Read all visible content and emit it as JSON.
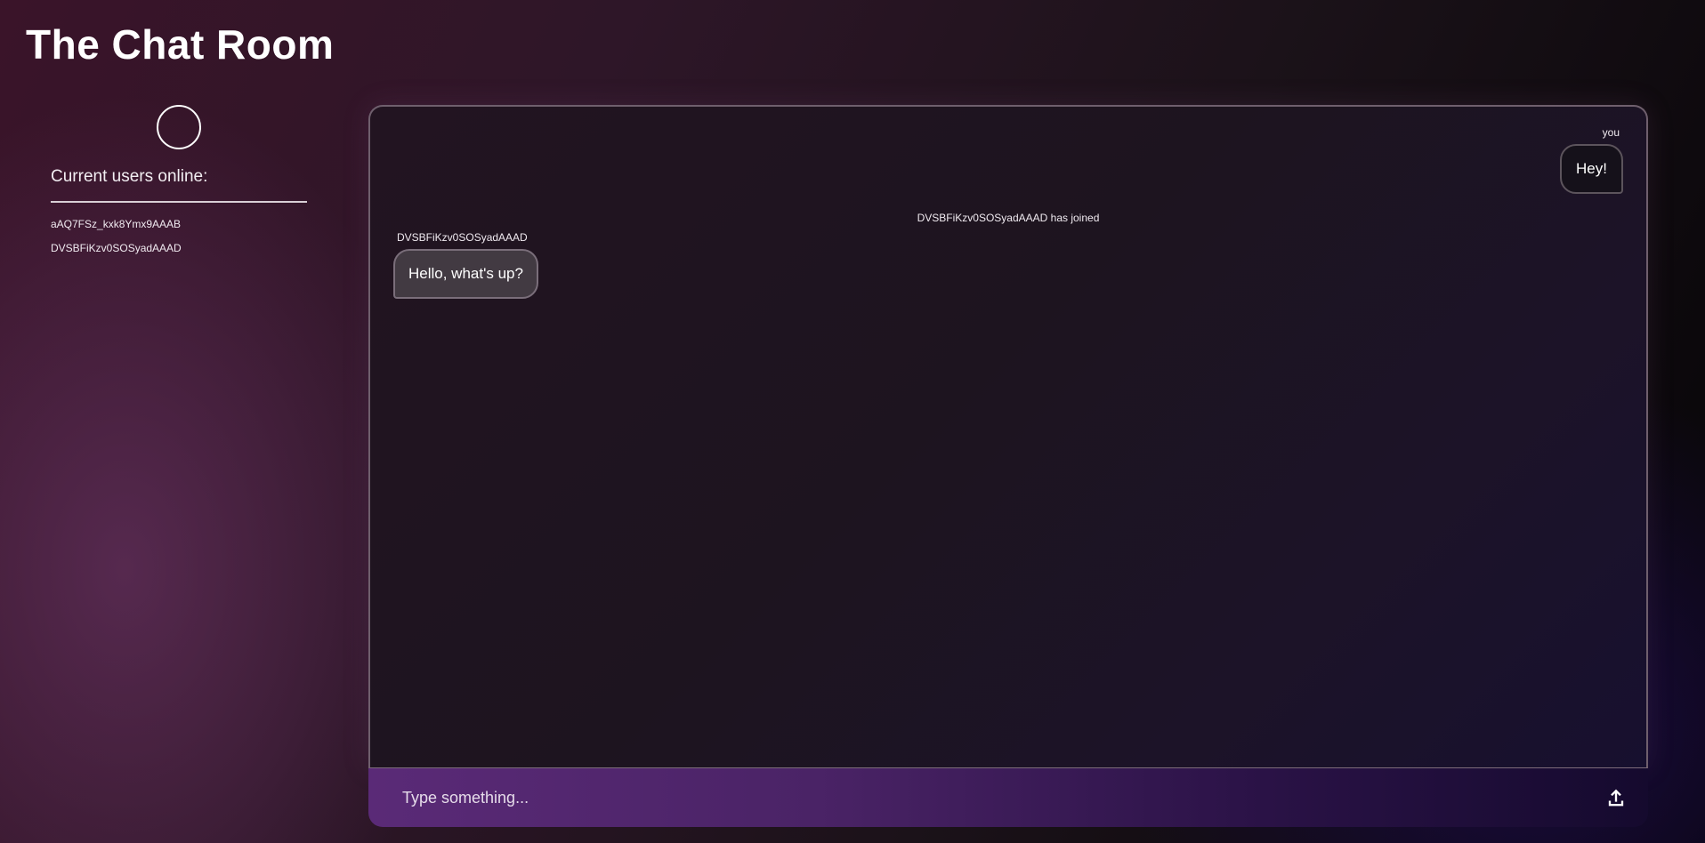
{
  "app": {
    "title": "The Chat Room"
  },
  "sidebar": {
    "online_title": "Current users online:",
    "users": [
      "aAQ7FSz_kxk8Ymx9AAAB",
      "DVSBFiKzv0SOSyadAAAD"
    ]
  },
  "chat": {
    "messages": [
      {
        "sender": "you",
        "text": "Hey!"
      },
      {
        "system": "DVSBFiKzv0SOSyadAAAD has joined"
      },
      {
        "sender": "DVSBFiKzv0SOSyadAAAD",
        "text": "Hello, what's up?"
      }
    ]
  },
  "composer": {
    "placeholder": "Type something...",
    "send_icon": "upload-icon"
  },
  "colors": {
    "bubble_own": "#15111a",
    "bubble_other": "#423a42",
    "composer_start": "#5a2a77",
    "composer_end": "#150a2e"
  }
}
